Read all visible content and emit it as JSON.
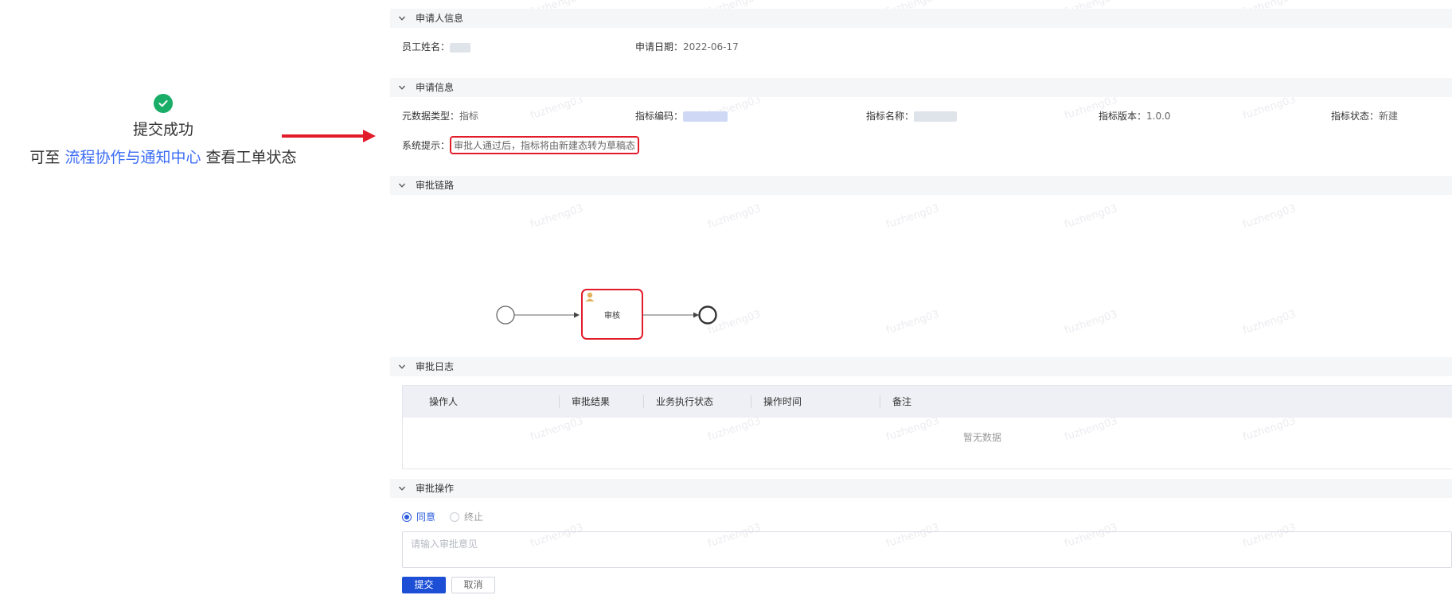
{
  "success": {
    "title": "提交成功",
    "hint_prefix": "可至",
    "hint_link": "流程协作与通知中心",
    "hint_suffix": "查看工单状态"
  },
  "watermark": "fuzheng03",
  "sections": {
    "applicant": "申请人信息",
    "apply": "申请信息",
    "chain": "审批链路",
    "log": "审批日志",
    "operation": "审批操作"
  },
  "applicant": {
    "name_label": "员工姓名：",
    "date_label": "申请日期：",
    "date_value": "2022-06-17"
  },
  "apply": {
    "type_label": "元数据类型：",
    "type_value": "指标",
    "code_label": "指标编码：",
    "name_label": "指标名称：",
    "version_label": "指标版本：",
    "version_value": "1.0.0",
    "status_label": "指标状态：",
    "status_value": "新建",
    "tip_label": "系统提示：",
    "tip_value": "审批人通过后，指标将由新建态转为草稿态"
  },
  "diagram": {
    "task_label": "审核"
  },
  "log_table": {
    "columns": [
      "操作人",
      "审批结果",
      "业务执行状态",
      "操作时间",
      "备注"
    ],
    "empty_text": "暂无数据"
  },
  "operation": {
    "options": [
      "同意",
      "终止"
    ],
    "selected": "同意",
    "placeholder": "请输入审批意见",
    "submit": "提交",
    "cancel": "取消"
  },
  "colors": {
    "accent": "#1d4fd6",
    "link": "#3b6cf5",
    "success": "#1aad67",
    "highlight": "#e21b2a"
  }
}
